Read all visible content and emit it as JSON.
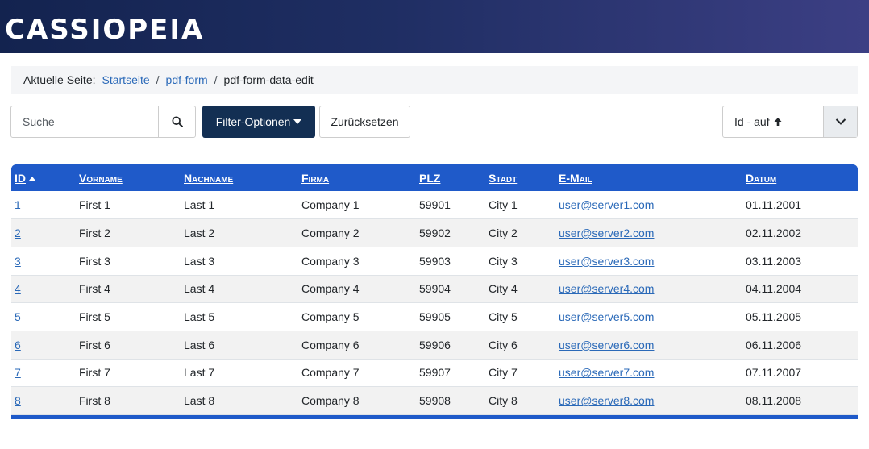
{
  "header": {
    "logo": "CASSIOPEIA"
  },
  "breadcrumb": {
    "label": "Aktuelle Seite:",
    "items": [
      {
        "label": "Startseite"
      },
      {
        "label": "pdf-form"
      },
      {
        "label": "pdf-form-data-edit"
      }
    ],
    "separator": "/"
  },
  "toolbar": {
    "search_placeholder": "Suche",
    "search_value": "",
    "filter_label": "Filter-Optionen",
    "reset_label": "Zurücksetzen",
    "sort_value": "Id - auf",
    "sort_arrow": "🠅"
  },
  "table": {
    "columns": [
      "ID",
      "Vorname",
      "Nachname",
      "Firma",
      "PLZ",
      "Stadt",
      "E-Mail",
      "Datum"
    ],
    "rows": [
      {
        "id": "1",
        "vorname": "First 1",
        "nachname": "Last 1",
        "firma": "Company 1",
        "plz": "59901",
        "stadt": "City 1",
        "email": "user@server1.com",
        "datum": "01.11.2001"
      },
      {
        "id": "2",
        "vorname": "First 2",
        "nachname": "Last 2",
        "firma": "Company 2",
        "plz": "59902",
        "stadt": "City 2",
        "email": "user@server2.com",
        "datum": "02.11.2002"
      },
      {
        "id": "3",
        "vorname": "First 3",
        "nachname": "Last 3",
        "firma": "Company 3",
        "plz": "59903",
        "stadt": "City 3",
        "email": "user@server3.com",
        "datum": "03.11.2003"
      },
      {
        "id": "4",
        "vorname": "First 4",
        "nachname": "Last 4",
        "firma": "Company 4",
        "plz": "59904",
        "stadt": "City 4",
        "email": "user@server4.com",
        "datum": "04.11.2004"
      },
      {
        "id": "5",
        "vorname": "First 5",
        "nachname": "Last 5",
        "firma": "Company 5",
        "plz": "59905",
        "stadt": "City 5",
        "email": "user@server5.com",
        "datum": "05.11.2005"
      },
      {
        "id": "6",
        "vorname": "First 6",
        "nachname": "Last 6",
        "firma": "Company 6",
        "plz": "59906",
        "stadt": "City 6",
        "email": "user@server6.com",
        "datum": "06.11.2006"
      },
      {
        "id": "7",
        "vorname": "First 7",
        "nachname": "Last 7",
        "firma": "Company 7",
        "plz": "59907",
        "stadt": "City 7",
        "email": "user@server7.com",
        "datum": "07.11.2007"
      },
      {
        "id": "8",
        "vorname": "First 8",
        "nachname": "Last 8",
        "firma": "Company 8",
        "plz": "59908",
        "stadt": "City 8",
        "email": "user@server8.com",
        "datum": "08.11.2008"
      }
    ]
  },
  "colors": {
    "header_start": "#13234f",
    "header_end": "#3c3f84",
    "table_header": "#1f5ac9",
    "primary_button": "#132f53",
    "link": "#2a69b8"
  },
  "icons": {
    "search": "search-icon",
    "sort_dropdown": "chevron-down-icon",
    "filter_caret": "caret-down-icon"
  }
}
